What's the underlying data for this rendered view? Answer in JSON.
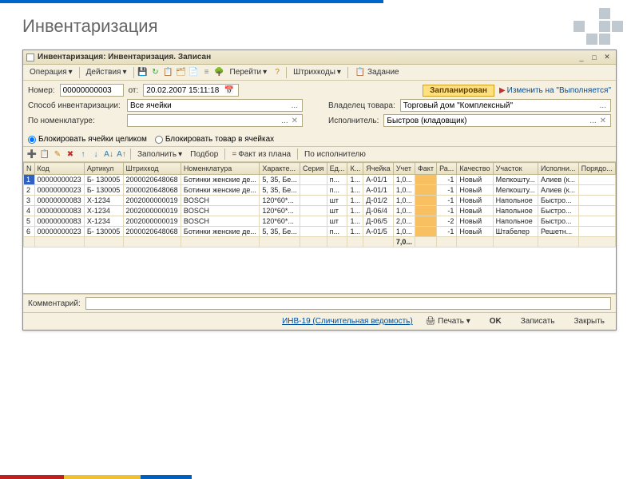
{
  "page_title": "Инвентаризация",
  "window": {
    "title": "Инвентаризация: Инвентаризация. Записан"
  },
  "toolbar": {
    "operation": "Операция",
    "actions": "Действия",
    "goto": "Перейти",
    "barcodes": "Штрихкоды",
    "task": "Задание"
  },
  "form": {
    "number_label": "Номер:",
    "number": "00000000003",
    "from_label": "от:",
    "date": "20.02.2007 15:11:18",
    "status": "Запланирован",
    "change_to": "Изменить на \"Выполняется\"",
    "method_label": "Способ инвентаризации:",
    "method": "Все ячейки",
    "owner_label": "Владелец товара:",
    "owner": "Торговый дом \"Комплексный\"",
    "nomen_label": "По номенклатуре:",
    "nomen": "",
    "executor_label": "Исполнитель:",
    "executor": "Быстров (кладовщик)"
  },
  "radios": {
    "block_cells": "Блокировать ячейки целиком",
    "block_goods": "Блокировать товар в ячейках"
  },
  "grid_toolbar": {
    "fill": "Заполнить",
    "select": "Подбор",
    "fact_plan": "Факт из плана",
    "by_executor": "По исполнителю"
  },
  "columns": [
    "N",
    "Код",
    "Артикул",
    "Штрихкод",
    "Номенклатура",
    "Характе...",
    "Серия",
    "Ед...",
    "К...",
    "Ячейка",
    "Учет",
    "Факт",
    "Ра...",
    "Качество",
    "Участок",
    "Исполни...",
    "Порядо..."
  ],
  "rows": [
    {
      "n": "1",
      "code": "00000000023",
      "art": "Б- 130005",
      "bc": "2000020648068",
      "nom": "Ботинки женские де...",
      "char": "5, 35, Бе...",
      "ser": "",
      "unit": "п...",
      "k": "1...",
      "cell": "А-01/1",
      "acct": "1,0...",
      "fact": "",
      "diff": "-1",
      "qual": "Новый",
      "area": "Мелкошту...",
      "exec": "Алиев (к..."
    },
    {
      "n": "2",
      "code": "00000000023",
      "art": "Б- 130005",
      "bc": "2000020648068",
      "nom": "Ботинки женские де...",
      "char": "5, 35, Бе...",
      "ser": "",
      "unit": "п...",
      "k": "1...",
      "cell": "А-01/1",
      "acct": "1,0...",
      "fact": "",
      "diff": "-1",
      "qual": "Новый",
      "area": "Мелкошту...",
      "exec": "Алиев (к..."
    },
    {
      "n": "3",
      "code": "00000000083",
      "art": "Х-1234",
      "bc": "2002000000019",
      "nom": "BOSCH",
      "char": "120*60*...",
      "ser": "",
      "unit": "шт",
      "k": "1...",
      "cell": "Д-01/2",
      "acct": "1,0...",
      "fact": "",
      "diff": "-1",
      "qual": "Новый",
      "area": "Напольное",
      "exec": "Быстро..."
    },
    {
      "n": "4",
      "code": "00000000083",
      "art": "Х-1234",
      "bc": "2002000000019",
      "nom": "BOSCH",
      "char": "120*60*...",
      "ser": "",
      "unit": "шт",
      "k": "1...",
      "cell": "Д-06/4",
      "acct": "1,0...",
      "fact": "",
      "diff": "-1",
      "qual": "Новый",
      "area": "Напольное",
      "exec": "Быстро..."
    },
    {
      "n": "5",
      "code": "00000000083",
      "art": "Х-1234",
      "bc": "2002000000019",
      "nom": "BOSCH",
      "char": "120*60*...",
      "ser": "",
      "unit": "шт",
      "k": "1...",
      "cell": "Д-06/5",
      "acct": "2,0...",
      "fact": "",
      "diff": "-2",
      "qual": "Новый",
      "area": "Напольное",
      "exec": "Быстро..."
    },
    {
      "n": "6",
      "code": "00000000023",
      "art": "Б- 130005",
      "bc": "2000020648068",
      "nom": "Ботинки женские де...",
      "char": "5, 35, Бе...",
      "ser": "",
      "unit": "п...",
      "k": "1...",
      "cell": "А-01/5",
      "acct": "1,0...",
      "fact": "",
      "diff": "-1",
      "qual": "Новый",
      "area": "Штабелер",
      "exec": "Решетн..."
    }
  ],
  "totals": {
    "acct": "7,0..."
  },
  "comment_label": "Комментарий:",
  "footer": {
    "inv19": "ИНВ-19 (Сличительная ведомость)",
    "print": "Печать",
    "ok": "OK",
    "save": "Записать",
    "close": "Закрыть"
  }
}
